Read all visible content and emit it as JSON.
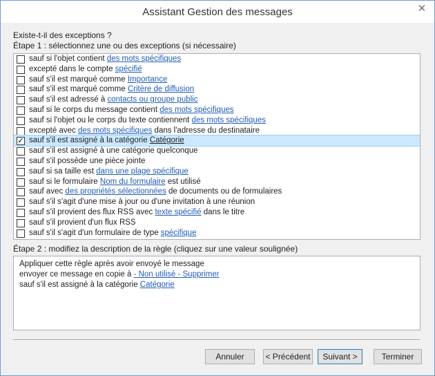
{
  "window": {
    "title": "Assistant Gestion des messages",
    "close_glyph": "✕"
  },
  "question": "Existe-t-il des exceptions ?",
  "step1_label": "Étape 1 : sélectionnez une ou des exceptions (si nécessaire)",
  "exceptions": [
    {
      "text": "sauf si l'objet contient ",
      "link": "des mots spécifiques",
      "after": "",
      "checked": false
    },
    {
      "text": "excepté dans le compte ",
      "link": "spécifié",
      "after": "",
      "checked": false
    },
    {
      "text": "sauf s'il est marqué comme ",
      "link": "Importance",
      "after": "",
      "checked": false
    },
    {
      "text": "sauf s'il est marqué comme ",
      "link": "Critère de diffusion",
      "after": "",
      "checked": false
    },
    {
      "text": "sauf s'il est adressé à ",
      "link": "contacts ou groupe public",
      "after": "",
      "checked": false
    },
    {
      "text": "sauf si le corps du message contient ",
      "link": "des mots spécifiques",
      "after": "",
      "checked": false
    },
    {
      "text": "sauf si l'objet ou le corps du texte contiennent ",
      "link": "des mots spécifiques",
      "after": "",
      "checked": false
    },
    {
      "text": "excepté avec ",
      "link": "des mots spécifiques",
      "after": " dans l'adresse du destinataire",
      "checked": false
    },
    {
      "text": "sauf s'il est assigné à la catégorie ",
      "link": "Catégorie",
      "after": "",
      "checked": true,
      "selected": true
    },
    {
      "text": "sauf s'il est assigné à une catégorie quelconque",
      "link": "",
      "after": "",
      "checked": false
    },
    {
      "text": "sauf s'il possède une pièce jointe",
      "link": "",
      "after": "",
      "checked": false
    },
    {
      "text": "sauf si sa taille est ",
      "link": "dans une plage spécifique",
      "after": "",
      "checked": false
    },
    {
      "text": "sauf si le formulaire ",
      "link": "Nom du formulaire",
      "after": " est utilisé",
      "checked": false
    },
    {
      "text": "sauf avec ",
      "link": "des propriétés sélectionnées",
      "after": " de documents ou de formulaires",
      "checked": false
    },
    {
      "text": "sauf s'il s'agit d'une mise à jour ou d'une invitation à une réunion",
      "link": "",
      "after": "",
      "checked": false
    },
    {
      "text": "sauf s'il provient des flux RSS avec ",
      "link": "texte spécifié",
      "after": " dans le titre",
      "checked": false
    },
    {
      "text": "sauf s'il provient d'un flux RSS",
      "link": "",
      "after": "",
      "checked": false
    },
    {
      "text": "sauf s'il s'agit d'un formulaire de type ",
      "link": "spécifique",
      "after": "",
      "checked": false
    }
  ],
  "step2_label": "Étape 2 : modifiez la description de la règle (cliquez sur une valeur soulignée)",
  "description": {
    "line1": "Appliquer cette règle après avoir envoyé le message",
    "line2_text": "envoyer ce message en copie à ",
    "line2_link": "- Non utilisé - Supprimer",
    "line3_text": "sauf s'il est assigné à la catégorie ",
    "line3_link": "Catégorie"
  },
  "buttons": {
    "cancel": "Annuler",
    "back": "< Précédent",
    "next": "Suivant >",
    "finish": "Terminer"
  },
  "colors": {
    "link": "#1f5cb5",
    "selection": "#cce8ff",
    "window_border": "#6b9bd4"
  }
}
